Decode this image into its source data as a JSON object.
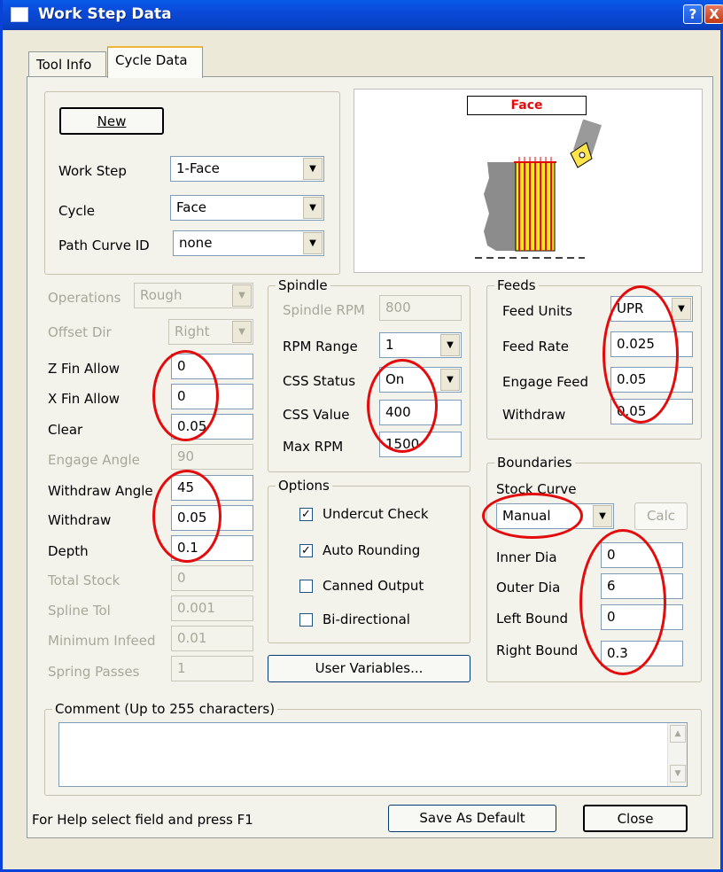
{
  "window": {
    "title": "Work Step Data",
    "help_symbol": "?",
    "close_symbol": "X"
  },
  "tabs": [
    {
      "label": "Tool Info",
      "active": false
    },
    {
      "label": "Cycle Data",
      "active": true
    }
  ],
  "top_group": {
    "new_button": "New",
    "work_step": {
      "label": "Work Step",
      "value": "1-Face"
    },
    "cycle": {
      "label": "Cycle",
      "value": "Face"
    },
    "path_curve": {
      "label": "Path Curve ID",
      "value": "none"
    }
  },
  "preview": {
    "caption": "Face"
  },
  "left_params": {
    "operations": {
      "label": "Operations",
      "value": "Rough",
      "enabled": false
    },
    "offset_dir": {
      "label": "Offset Dir",
      "value": "Right",
      "enabled": false
    },
    "z_fin_allow": {
      "label": "Z Fin Allow",
      "value": "0"
    },
    "x_fin_allow": {
      "label": "X Fin Allow",
      "value": "0"
    },
    "clear": {
      "label": "Clear",
      "value": "0.05"
    },
    "engage_angle": {
      "label": "Engage Angle",
      "value": "90",
      "enabled": false
    },
    "withdraw_angle": {
      "label": "Withdraw Angle",
      "value": "45"
    },
    "withdraw": {
      "label": "Withdraw",
      "value": "0.05"
    },
    "depth": {
      "label": "Depth",
      "value": "0.1"
    },
    "total_stock": {
      "label": "Total Stock",
      "value": "0",
      "enabled": false
    },
    "spline_tol": {
      "label": "Spline Tol",
      "value": "0.001",
      "enabled": false
    },
    "minimum_infeed": {
      "label": "Minimum Infeed",
      "value": "0.01",
      "enabled": false
    },
    "spring_passes": {
      "label": "Spring Passes",
      "value": "1",
      "enabled": false
    }
  },
  "spindle": {
    "title": "Spindle",
    "spindle_rpm": {
      "label": "Spindle RPM",
      "value": "800",
      "enabled": false
    },
    "rpm_range": {
      "label": "RPM Range",
      "value": "1"
    },
    "css_status": {
      "label": "CSS Status",
      "value": "On"
    },
    "css_value": {
      "label": "CSS Value",
      "value": "400"
    },
    "max_rpm": {
      "label": "Max RPM",
      "value": "1500"
    }
  },
  "feeds": {
    "title": "Feeds",
    "feed_units": {
      "label": "Feed Units",
      "value": "UPR"
    },
    "feed_rate": {
      "label": "Feed Rate",
      "value": "0.025"
    },
    "engage_feed": {
      "label": "Engage Feed",
      "value": "0.05"
    },
    "withdraw": {
      "label": "Withdraw",
      "value": "0.05"
    }
  },
  "options": {
    "title": "Options",
    "items": [
      {
        "label": "Undercut Check",
        "checked": true
      },
      {
        "label": "Auto Rounding",
        "checked": true
      },
      {
        "label": "Canned Output",
        "checked": false
      },
      {
        "label": "Bi-directional",
        "checked": false
      }
    ],
    "user_variables_button": "User Variables..."
  },
  "boundaries": {
    "title": "Boundaries",
    "stock_curve": {
      "label": "Stock Curve",
      "value": "Manual"
    },
    "calc_button": "Calc",
    "inner_dia": {
      "label": "Inner Dia",
      "value": "0"
    },
    "outer_dia": {
      "label": "Outer Dia",
      "value": "6"
    },
    "left_bound": {
      "label": "Left Bound",
      "value": "0"
    },
    "right_bound": {
      "label": "Right Bound",
      "value": "0.3"
    }
  },
  "comment": {
    "title": "Comment  (Up to 255 characters)",
    "value": ""
  },
  "footer": {
    "status": "For Help select field and press F1",
    "save_default_button": "Save As Default",
    "close_button": "Close"
  },
  "colors": {
    "titlebar": "#0b49d8",
    "annotation": "#e30b0b",
    "preview_part": "#f7ea1c"
  }
}
